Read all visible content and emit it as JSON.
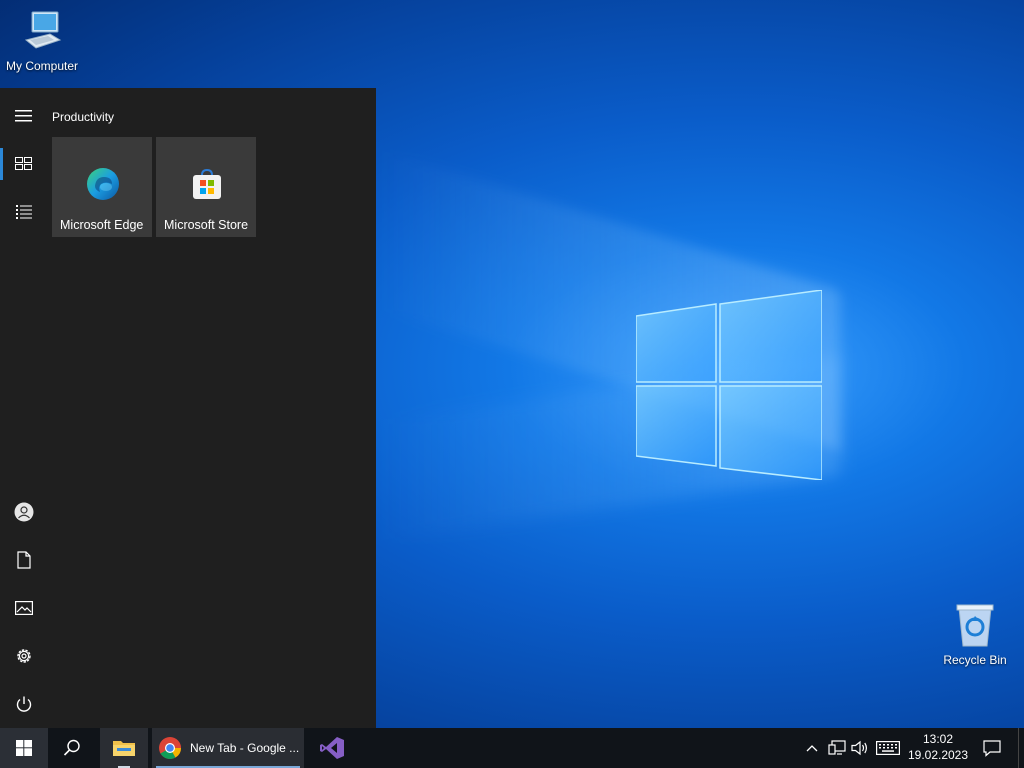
{
  "desktop": {
    "icons": [
      {
        "label": "My Computer"
      },
      {
        "label": "Recycle Bin"
      }
    ]
  },
  "start_menu": {
    "group_title": "Productivity",
    "tiles": [
      {
        "label": "Microsoft Edge",
        "icon": "edge-icon"
      },
      {
        "label": "Microsoft Store",
        "icon": "store-icon"
      }
    ],
    "rail_icons": [
      "hamburger-menu-icon",
      "tiles-icon",
      "all-apps-list-icon",
      "user-account-icon",
      "documents-icon",
      "pictures-icon",
      "settings-icon",
      "power-icon"
    ]
  },
  "taskbar": {
    "chrome_label": "New Tab - Google ...",
    "time": "13:02",
    "date": "19.02.2023"
  },
  "colors": {
    "accent": "#2b88d8",
    "start_menu_bg": "#1f1f1f",
    "tile_bg": "#3a3a3a",
    "taskbar_bg": "#101419"
  }
}
